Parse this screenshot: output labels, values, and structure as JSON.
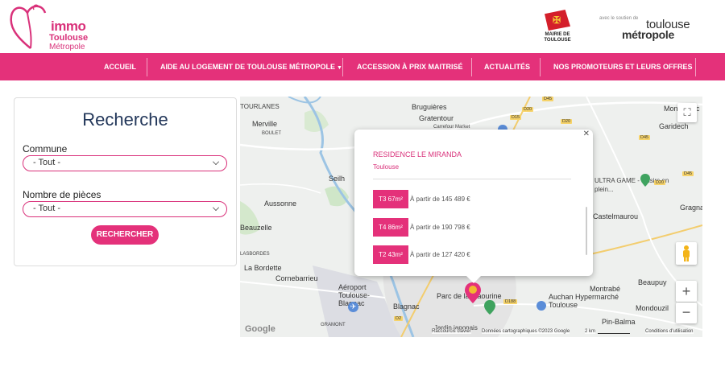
{
  "header": {
    "logo": {
      "immo": "immo",
      "toulouse": "Toulouse",
      "metropole": "Métropole"
    },
    "mairie": "MAIRIE DE TOULOUSE",
    "soutien": "avec le soutien de",
    "tm_toulouse": "toulouse",
    "tm_metropole": "métropole"
  },
  "nav": {
    "items": [
      {
        "label": "ACCUEIL"
      },
      {
        "label": "AIDE AU LOGEMENT DE TOULOUSE MÉTROPOLE"
      },
      {
        "label": "ACCESSION À PRIX MAITRISÉ"
      },
      {
        "label": "ACTUALITÉS"
      },
      {
        "label": "NOS PROMOTEURS ET LEURS OFFRES"
      }
    ]
  },
  "search": {
    "title": "Recherche",
    "commune_label": "Commune",
    "commune_value": "- Tout -",
    "pieces_label": "Nombre de pièces",
    "pieces_value": "- Tout -",
    "button": "RECHERCHER"
  },
  "map": {
    "labels": [
      "TOURLANES",
      "Merville",
      "BOULET",
      "Bruguières",
      "Gratentour",
      "Carrefour Market",
      "Montastruc",
      "Garidech",
      "Seilh",
      "Aussonne",
      "Beauzelle",
      "Castelmaurou",
      "Gragnague",
      "La Bordette",
      "LASBORDES",
      "Cornebarrieu",
      "Aéroport Toulouse-Blagnac",
      "Blagnac",
      "Parc de la Maourine",
      "Auchan Hypermarché Toulouse",
      "Montrabé",
      "Beaupuy",
      "Mondouzil",
      "Pin-Balma",
      "GRAMONT",
      "Jardin japonais",
      "ULTRA GAME - Loisirs en plein..."
    ],
    "roads": [
      "D45",
      "D20",
      "D15",
      "D20",
      "D45",
      "D20",
      "D45",
      "D188",
      "D2"
    ],
    "google": "Google",
    "footer": {
      "shortcuts": "Raccourcis clavier",
      "data": "Données cartographiques ©2023 Google",
      "scale": "2 km",
      "terms": "Conditions d'utilisation"
    },
    "popup": {
      "title": "RESIDENCE LE MIRANDA",
      "city": "Toulouse",
      "offers": [
        {
          "type": "T3 67m²",
          "price": "À partir de 145 489 €"
        },
        {
          "type": "T4 86m²",
          "price": "À partir de 190 798 €"
        },
        {
          "type": "T2 43m²",
          "price": "À partir de 127 420 €"
        }
      ]
    }
  },
  "colors": {
    "brand": "#e4317a",
    "title": "#23375a"
  }
}
